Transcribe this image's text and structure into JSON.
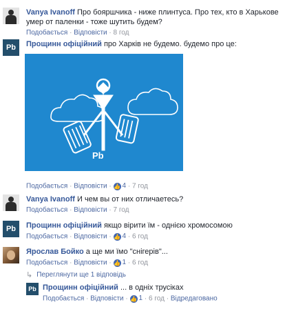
{
  "comments": [
    {
      "author": "Vanya Ivanoff",
      "text_line1": "Про бояршчика - ниже плинтуса. Про тех, кто в Харькове",
      "text_line2": "умер от паленки - тоже шутить будем?",
      "like": "Подобається",
      "reply": "Відповісти",
      "time": "8 год"
    },
    {
      "author": "Прощинн офіційний",
      "text": "про Харків не будемо. будемо про це:",
      "like": "Подобається",
      "reply": "Відповісти",
      "reactions": "4",
      "time": "7 год"
    },
    {
      "author": "Vanya Ivanoff",
      "text": "И чем вы от них отличаетесь?",
      "like": "Подобається",
      "reply": "Відповісти",
      "time": "7 год"
    },
    {
      "author": "Прощинн офіційний",
      "text": "якщо вірити їм - однією хромосомою",
      "like": "Подобається",
      "reply": "Відповісти",
      "reactions": "4",
      "time": "6 год"
    },
    {
      "author": "Ярослав Бойко",
      "text": "а ще ми їмо \"снігерів\"...",
      "like": "Подобається",
      "reply": "Відповісти",
      "reactions": "1",
      "time": "6 год"
    }
  ],
  "more_replies": "Переглянути ще 1 відповідь",
  "nested_reply": {
    "author": "Прощинн офіційний",
    "text": "... в одніх трусіках",
    "like": "Подобається",
    "reply": "Відповісти",
    "reactions": "1",
    "time": "6 год",
    "edited": "Відредаговано"
  },
  "attachment": {
    "logo_text": "Pb"
  },
  "avatar_text": "Pb",
  "colors": {
    "author": "#365899",
    "link": "#4b67a1",
    "meta": "#90949c",
    "attachment_bg": "#1f88cf",
    "like_badge": "#4267b2"
  }
}
